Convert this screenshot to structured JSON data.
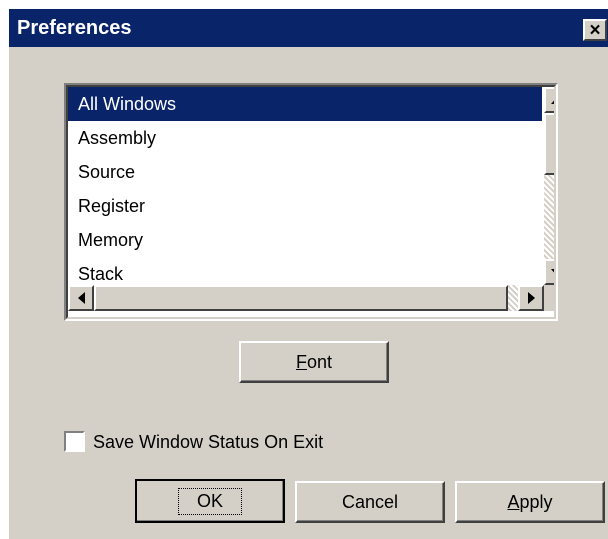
{
  "dialog": {
    "title": "Preferences",
    "close_glyph": "×"
  },
  "listbox": {
    "selected_index": 0,
    "items": [
      "All Windows",
      "Assembly",
      "Source",
      "Register",
      "Memory",
      "Stack"
    ]
  },
  "buttons": {
    "font": {
      "accel": "F",
      "rest": "ont"
    },
    "ok": "OK",
    "cancel": "Cancel",
    "apply": {
      "accel": "A",
      "rest": "pply"
    }
  },
  "checkbox": {
    "label": "Save Window Status On Exit",
    "checked": false
  },
  "icons": {
    "close": "close-icon",
    "scroll_up": "arrow-up-icon",
    "scroll_down": "arrow-down-icon",
    "scroll_left": "arrow-left-icon",
    "scroll_right": "arrow-right-icon"
  },
  "colors": {
    "titlebar": "#0a246a",
    "face": "#d4d0c8",
    "selection": "#0a246a"
  }
}
